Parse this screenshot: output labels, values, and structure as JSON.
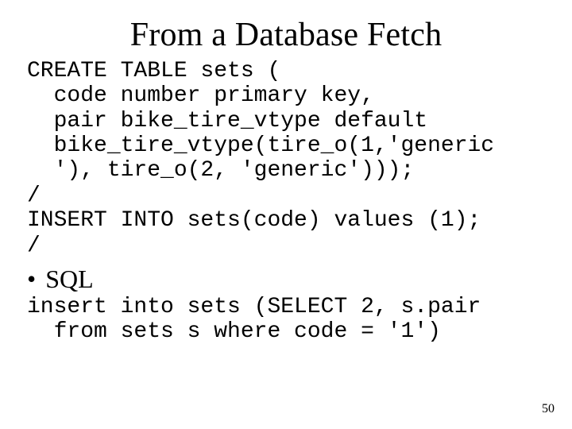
{
  "title": "From a Database Fetch",
  "code_block_1_lines": [
    "CREATE TABLE sets (",
    "  code number primary key,",
    "  pair bike_tire_vtype default",
    "  bike_tire_vtype(tire_o(1,'generic",
    "  '), tire_o(2, 'generic')));",
    "/",
    "INSERT INTO sets(code) values (1);",
    "/"
  ],
  "bullet_label": "SQL",
  "code_block_2_lines": [
    "insert into sets (SELECT 2, s.pair",
    "  from sets s where code = '1')"
  ],
  "page_number": "50"
}
